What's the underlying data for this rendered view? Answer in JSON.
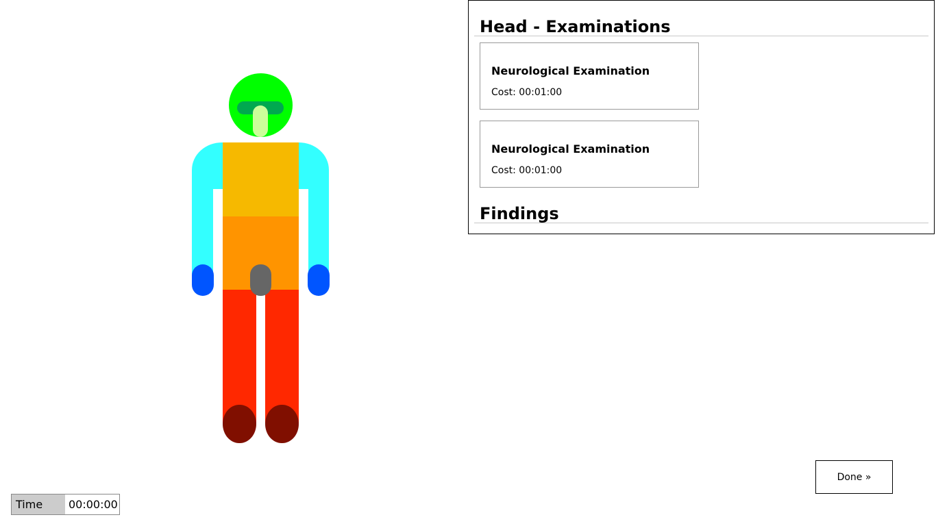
{
  "panel": {
    "title": "Head - Examinations",
    "exams": [
      {
        "name": "Neurological Examination",
        "cost": "Cost: 00:01:00"
      },
      {
        "name": "Neurological Examination",
        "cost": "Cost: 00:01:00"
      }
    ],
    "findings_title": "Findings"
  },
  "done_button": {
    "label": "Done »"
  },
  "timer": {
    "label": "Time",
    "value": "00:00:00"
  },
  "body_part_colors": {
    "head": "#00ff00",
    "eyes": "#00a94f",
    "nose_mouth": "#ccff99",
    "arms": "#33ffff",
    "hands": "#0055ff",
    "chest": "#f6b900",
    "abdomen": "#ff9400",
    "groin": "#666666",
    "legs": "#ff2800",
    "feet": "#800f00"
  }
}
